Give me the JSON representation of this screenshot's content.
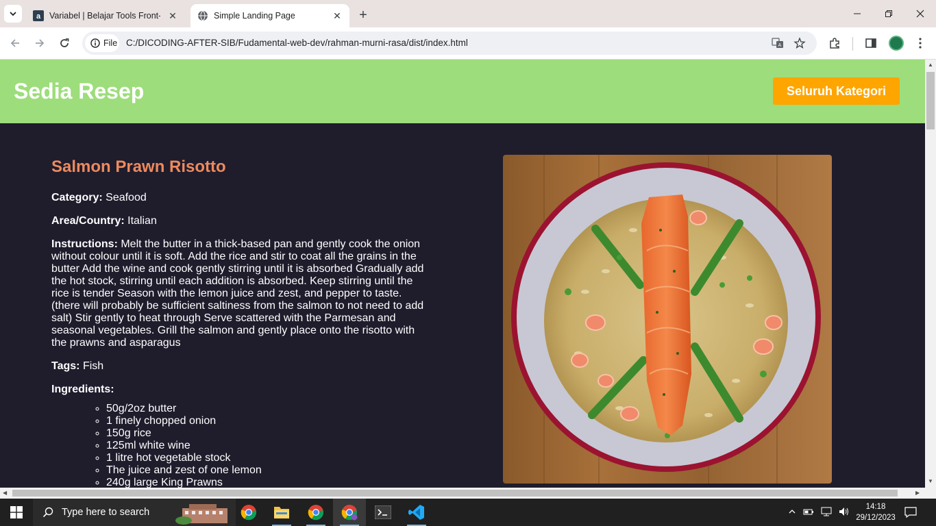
{
  "browser": {
    "tabs": [
      {
        "title": "Variabel | Belajar Tools Front-End",
        "active": false
      },
      {
        "title": "Simple Landing Page",
        "active": true
      }
    ],
    "site_chip": "File",
    "url": "C:/DICODING-AFTER-SIB/Fudamental-web-dev/rahman-murni-rasa/dist/index.html"
  },
  "header": {
    "brand": "Sedia Resep",
    "cta_label": "Seluruh Kategori"
  },
  "recipe": {
    "title": "Salmon Prawn Risotto",
    "category_label": "Category:",
    "category": "Seafood",
    "area_label": "Area/Country:",
    "area": "Italian",
    "instructions_label": "Instructions:",
    "instructions": "Melt the butter in a thick-based pan and gently cook the onion without colour until it is soft. Add the rice and stir to coat all the grains in the butter Add the wine and cook gently stirring until it is absorbed Gradually add the hot stock, stirring until each addition is absorbed. Keep stirring until the rice is tender Season with the lemon juice and zest, and pepper to taste. (there will probably be sufficient saltiness from the salmon to not need to add salt) Stir gently to heat through Serve scattered with the Parmesan and seasonal vegetables. Grill the salmon and gently place onto the risotto with the prawns and asparagus",
    "tags_label": "Tags:",
    "tags": "Fish",
    "ingredients_label": "Ingredients:",
    "ingredients": [
      "50g/2oz butter",
      "1 finely chopped onion",
      "150g rice",
      "125ml white wine",
      "1 litre hot vegetable stock",
      "The juice and zest of one lemon",
      "240g large King Prawns"
    ]
  },
  "taskbar": {
    "search_placeholder": "Type here to search",
    "time": "14:18",
    "date": "29/12/2023"
  },
  "colors": {
    "header_bg": "#9ddd7b",
    "page_bg": "#1f1c2c",
    "cta_bg": "#ffa500",
    "title_color": "#ec8a5e"
  }
}
